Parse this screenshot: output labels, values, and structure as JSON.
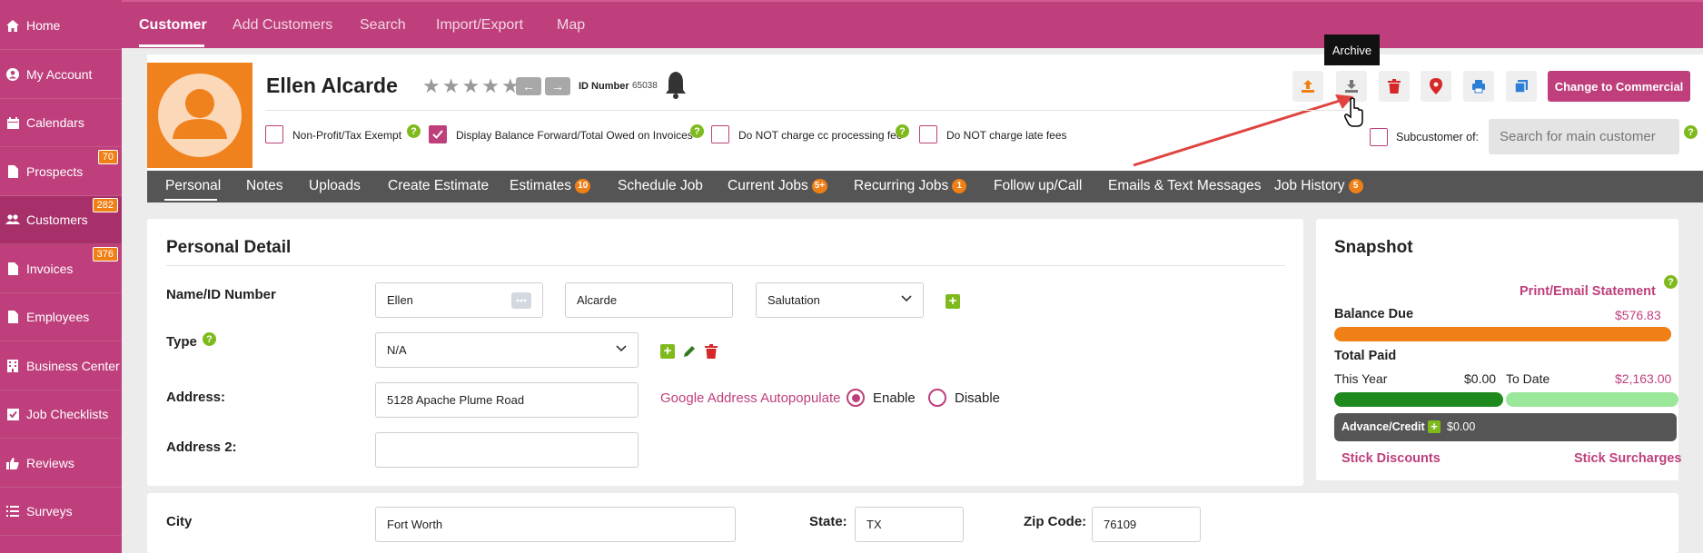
{
  "sidebar": {
    "items": [
      {
        "label": "Home",
        "icon": "home-icon"
      },
      {
        "label": "My Account",
        "icon": "user-circle-icon"
      },
      {
        "label": "Calendars",
        "icon": "calendar-icon"
      },
      {
        "label": "Prospects",
        "icon": "document-icon",
        "badge": "70"
      },
      {
        "label": "Customers",
        "icon": "users-icon",
        "badge": "282"
      },
      {
        "label": "Invoices",
        "icon": "document-icon",
        "badge": "376"
      },
      {
        "label": "Employees",
        "icon": "document-icon"
      },
      {
        "label": "Business Center",
        "icon": "building-icon"
      },
      {
        "label": "Job Checklists",
        "icon": "checkbox-icon"
      },
      {
        "label": "Reviews",
        "icon": "thumbs-up-icon"
      },
      {
        "label": "Surveys",
        "icon": "list-icon"
      }
    ]
  },
  "topnav": {
    "tabs": [
      "Customer",
      "Add Customers",
      "Search",
      "Import/Export",
      "Map"
    ]
  },
  "customer": {
    "name": "Ellen Alcarde",
    "id_label": "ID Number",
    "id_value": "65038"
  },
  "header": {
    "tooltip": "Archive",
    "change_button": "Change to Commercial",
    "checkboxes": [
      {
        "label": "Non-Profit/Tax Exempt",
        "checked": false
      },
      {
        "label": "Display Balance Forward/Total Owed on Invoices",
        "checked": true
      },
      {
        "label": "Do NOT charge cc processing fee",
        "checked": false
      },
      {
        "label": "Do NOT charge late fees",
        "checked": false
      }
    ],
    "subcustomer_label": "Subcustomer of:",
    "subcustomer_placeholder": "Search for main customer"
  },
  "subnav": {
    "tabs": [
      {
        "label": "Personal"
      },
      {
        "label": "Notes"
      },
      {
        "label": "Uploads"
      },
      {
        "label": "Create Estimate"
      },
      {
        "label": "Estimates",
        "badge": "10"
      },
      {
        "label": "Schedule Job"
      },
      {
        "label": "Current Jobs",
        "badge": "5+"
      },
      {
        "label": "Recurring Jobs",
        "badge": "1"
      },
      {
        "label": "Follow up/Call"
      },
      {
        "label": "Emails & Text Messages"
      },
      {
        "label": "Job History",
        "badge": "5"
      }
    ]
  },
  "personal": {
    "title": "Personal Detail",
    "name_label": "Name/ID Number",
    "first_name": "Ellen",
    "last_name": "Alcarde",
    "salutation": "Salutation",
    "type_label": "Type",
    "type_value": "N/A",
    "address_label": "Address:",
    "address_value": "5128 Apache Plume Road",
    "autopop_label": "Google Address Autopopulate",
    "enable_label": "Enable",
    "disable_label": "Disable",
    "address2_label": "Address 2:",
    "address2_value": "",
    "city_label": "City",
    "city_value": "Fort Worth",
    "state_label": "State:",
    "state_value": "TX",
    "zip_label": "Zip Code:",
    "zip_value": "76109"
  },
  "snapshot": {
    "title": "Snapshot",
    "print_link": "Print/Email Statement",
    "balance_label": "Balance Due",
    "balance_value": "$576.83",
    "total_paid_label": "Total Paid",
    "this_year_label": "This Year",
    "this_year_value": "$0.00",
    "to_date_label": "To Date",
    "to_date_value": "$2,163.00",
    "advance_label": "Advance/Credit",
    "advance_value": "$0.00",
    "stick_discounts": "Stick Discounts",
    "stick_surcharges": "Stick Surcharges"
  },
  "colors": {
    "brand": "#be3f7c",
    "badge": "#f07f16",
    "help": "#7fba1d",
    "balance_bar": "#f07f16",
    "year_bar": "#1e8a1e",
    "todate_bar": "#9be89b"
  }
}
